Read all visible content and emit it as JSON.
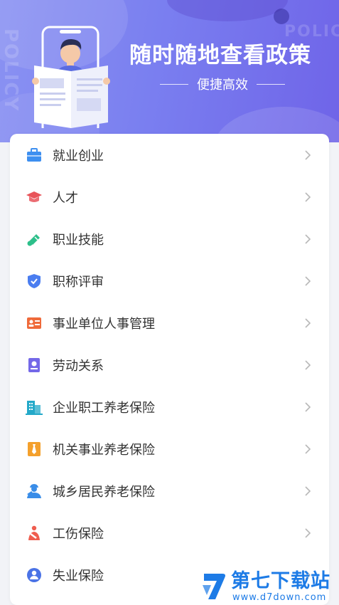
{
  "banner": {
    "title": "随时随地查看政策",
    "subtitle": "便捷高效",
    "bg_text_vertical": "POLICY",
    "bg_text_horizontal": "POLIC"
  },
  "menu": {
    "items": [
      {
        "label": "就业创业",
        "icon": "briefcase-icon",
        "color": "#3d8ff0"
      },
      {
        "label": "人才",
        "icon": "graduation-cap-icon",
        "color": "#e8545a"
      },
      {
        "label": "职业技能",
        "icon": "tools-icon",
        "color": "#2dbf8a"
      },
      {
        "label": "职称评审",
        "icon": "shield-check-icon",
        "color": "#4a7df0"
      },
      {
        "label": "事业单位人事管理",
        "icon": "id-card-icon",
        "color": "#ef6a3a"
      },
      {
        "label": "劳动关系",
        "icon": "contract-icon",
        "color": "#7468e8"
      },
      {
        "label": "企业职工养老保险",
        "icon": "building-icon",
        "color": "#24a9c9"
      },
      {
        "label": "机关事业养老保险",
        "icon": "tie-icon",
        "color": "#f4a02c"
      },
      {
        "label": "城乡居民养老保险",
        "icon": "worker-icon",
        "color": "#3a8de8"
      },
      {
        "label": "工伤保险",
        "icon": "injury-icon",
        "color": "#ef5d4f"
      },
      {
        "label": "失业保险",
        "icon": "person-badge-icon",
        "color": "#4b73e6"
      }
    ]
  },
  "watermark": {
    "text": "第七下载站",
    "url": "www.d7down.com",
    "color": "#1d7be6"
  }
}
